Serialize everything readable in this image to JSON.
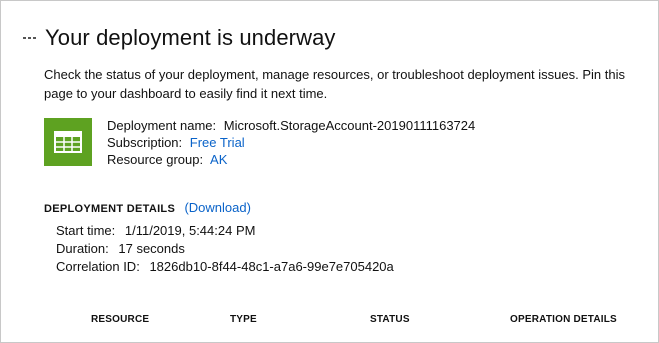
{
  "header": {
    "title": "Your deployment is underway",
    "description": "Check the status of your deployment, manage resources, or troubleshoot deployment issues. Pin this page to your dashboard to easily find it next time."
  },
  "summary": {
    "icon": "storage-table-icon",
    "tile_color": "#5ea221",
    "deployment_name_label": "Deployment name:",
    "deployment_name": "Microsoft.StorageAccount-20190111163724",
    "subscription_label": "Subscription:",
    "subscription": "Free Trial",
    "resource_group_label": "Resource group:",
    "resource_group": "AK"
  },
  "details": {
    "heading": "DEPLOYMENT DETAILS",
    "download_label": "(Download)",
    "start_time_label": "Start time:",
    "start_time": "1/11/2019, 5:44:24 PM",
    "duration_label": "Duration:",
    "duration": "17 seconds",
    "correlation_label": "Correlation ID:",
    "correlation_id": "1826db10-8f44-48c1-a7a6-99e7e705420a"
  },
  "table": {
    "columns": [
      "RESOURCE",
      "TYPE",
      "STATUS",
      "OPERATION DETAILS"
    ]
  },
  "colors": {
    "link": "#0a63c9",
    "tile": "#5ea221"
  }
}
